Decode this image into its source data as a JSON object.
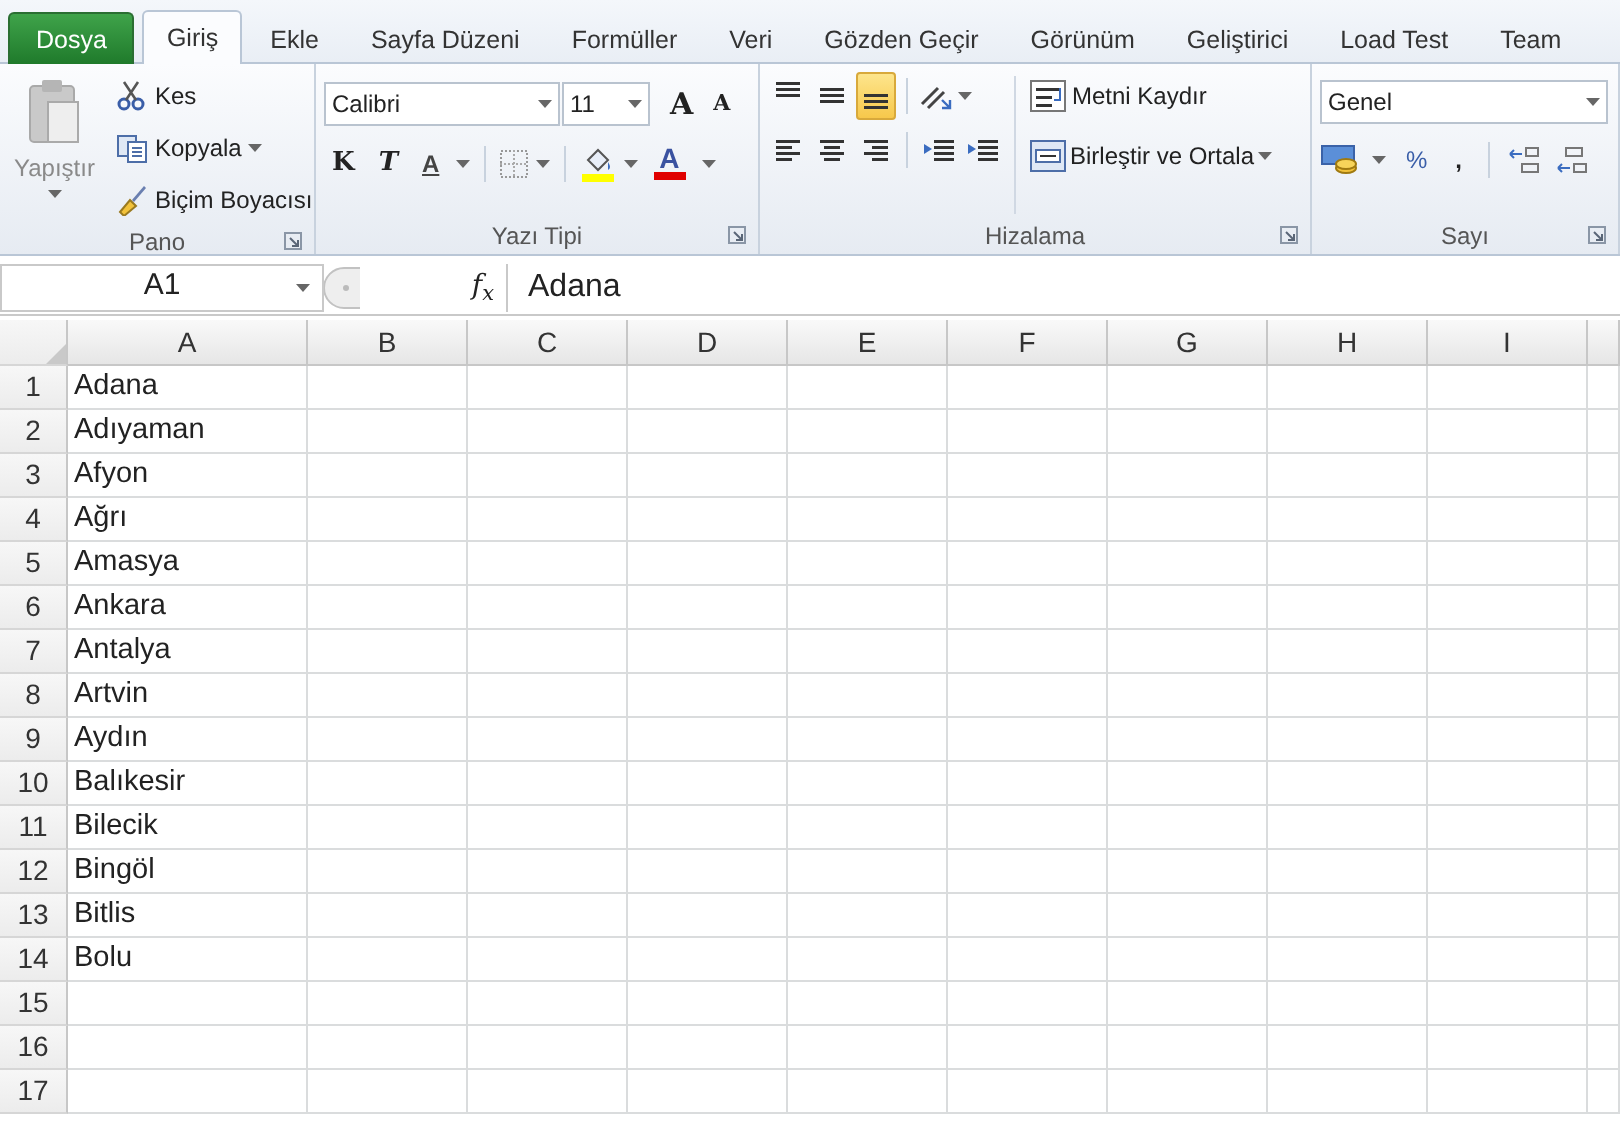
{
  "tabs": [
    {
      "label": "Dosya",
      "kind": "file",
      "selected": false
    },
    {
      "label": "Giriş",
      "kind": "tab",
      "selected": true
    },
    {
      "label": "Ekle",
      "kind": "tab",
      "selected": false
    },
    {
      "label": "Sayfa Düzeni",
      "kind": "tab",
      "selected": false
    },
    {
      "label": "Formüller",
      "kind": "tab",
      "selected": false
    },
    {
      "label": "Veri",
      "kind": "tab",
      "selected": false
    },
    {
      "label": "Gözden Geçir",
      "kind": "tab",
      "selected": false
    },
    {
      "label": "Görünüm",
      "kind": "tab",
      "selected": false
    },
    {
      "label": "Geliştirici",
      "kind": "tab",
      "selected": false
    },
    {
      "label": "Load Test",
      "kind": "tab",
      "selected": false
    },
    {
      "label": "Team",
      "kind": "tab",
      "selected": false
    }
  ],
  "clipboard": {
    "label": "Pano",
    "paste": {
      "label": "Yapıştır",
      "disabled": true
    },
    "items": [
      {
        "label": "Kes",
        "dropdown": false
      },
      {
        "label": "Kopyala",
        "dropdown": true
      },
      {
        "label": "Biçim Boyacısı",
        "dropdown": false
      }
    ]
  },
  "font": {
    "label": "Yazı Tipi",
    "name": "Calibri",
    "size": "11",
    "grow": "A",
    "shrink": "A",
    "bold": "K",
    "italic": "T",
    "underline": "A",
    "font_color_label": "A"
  },
  "alignment": {
    "label": "Hizalama",
    "vertical": [
      {
        "selected": false
      },
      {
        "selected": false
      },
      {
        "selected": true
      }
    ],
    "wrap": "Metni Kaydır",
    "merge": "Birleştir ve Ortala"
  },
  "number": {
    "label": "Sayı",
    "format": "Genel",
    "percent": "%",
    "comma": ","
  },
  "formula_bar": {
    "name_box": "A1",
    "fx": "f$_{x}$",
    "value": "Adana"
  },
  "sheet": {
    "columns": [
      "A",
      "B",
      "C",
      "D",
      "E",
      "F",
      "G",
      "H",
      "I"
    ],
    "rows": [
      {
        "number": "1",
        "value": "Adana"
      },
      {
        "number": "2",
        "value": "Adıyaman"
      },
      {
        "number": "3",
        "value": "Afyon"
      },
      {
        "number": "4",
        "value": "Ağrı"
      },
      {
        "number": "5",
        "value": "Amasya"
      },
      {
        "number": "6",
        "value": "Ankara"
      },
      {
        "number": "7",
        "value": "Antalya"
      },
      {
        "number": "8",
        "value": "Artvin"
      },
      {
        "number": "9",
        "value": "Aydın"
      },
      {
        "number": "10",
        "value": "Balıkesir"
      },
      {
        "number": "11",
        "value": "Bilecik"
      },
      {
        "number": "12",
        "value": "Bingöl"
      },
      {
        "number": "13",
        "value": "Bitlis"
      },
      {
        "number": "14",
        "value": "Bolu"
      },
      {
        "number": "15"
      },
      {
        "number": "16"
      },
      {
        "number": "17"
      }
    ]
  }
}
